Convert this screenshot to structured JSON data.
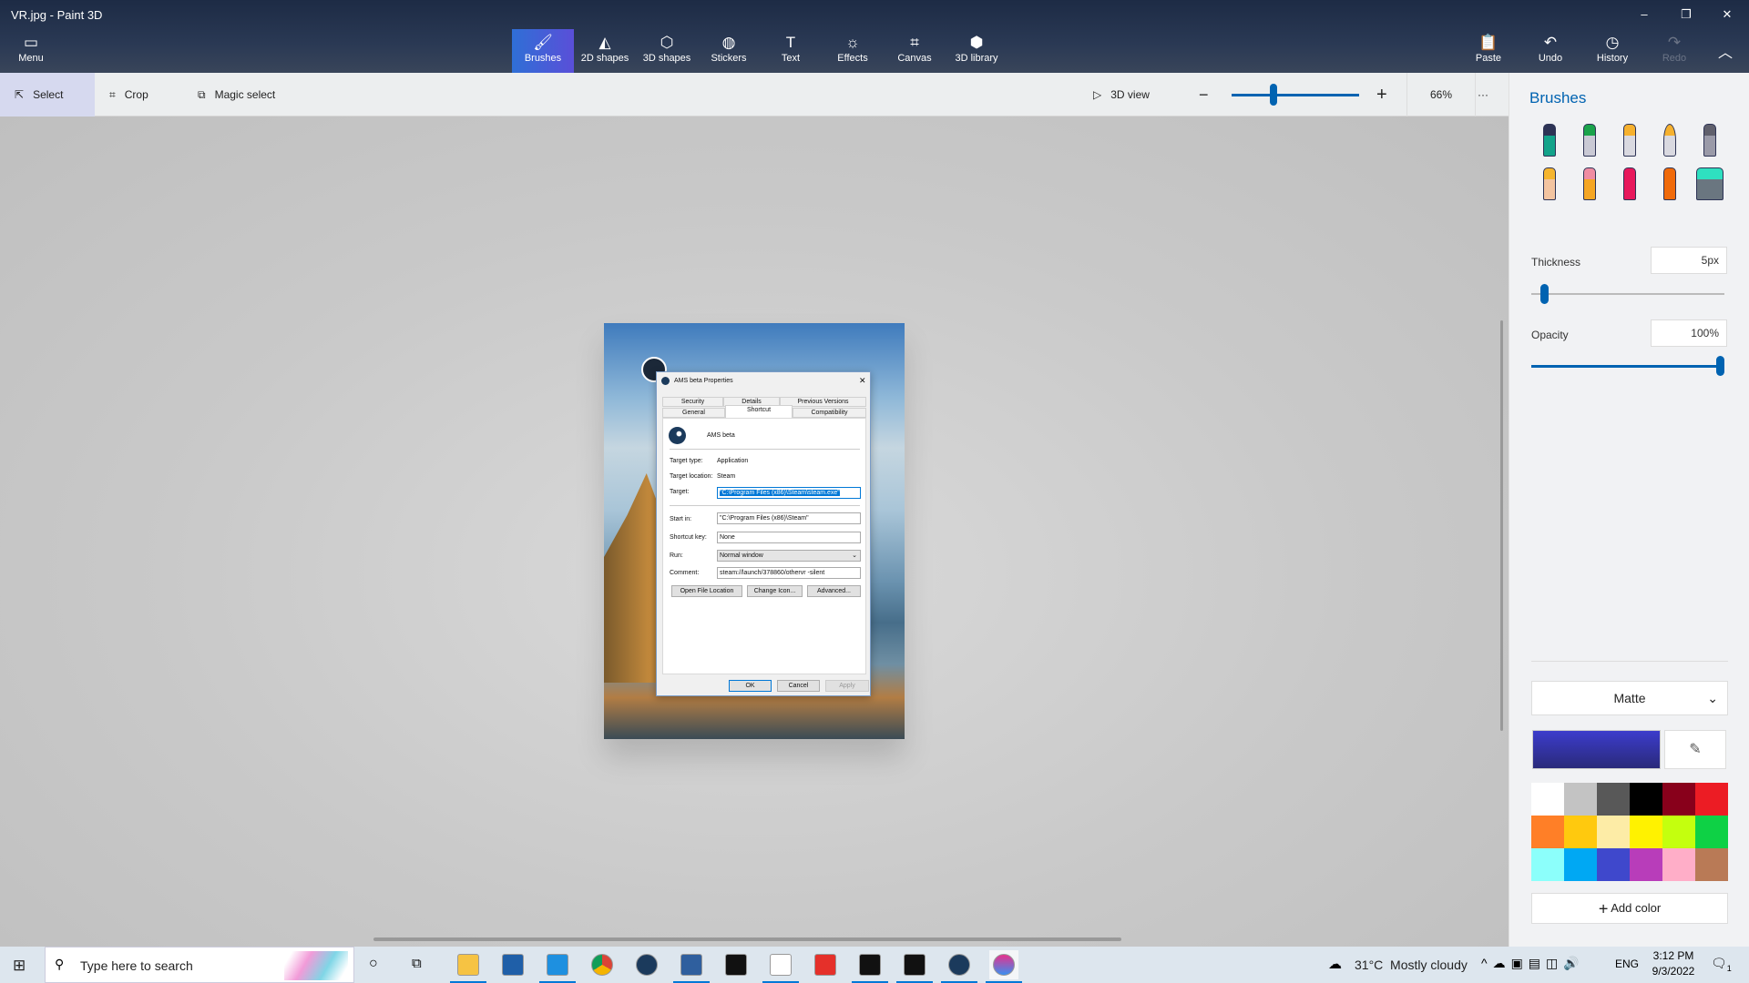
{
  "window": {
    "title": "VR.jpg - Paint 3D",
    "minimize": "–",
    "maximize": "❐",
    "close": "✕"
  },
  "menu": {
    "label": "Menu"
  },
  "tools": [
    {
      "label": "Brushes",
      "icon": "brush-icon",
      "active": true
    },
    {
      "label": "2D shapes",
      "icon": "2d-shapes-icon"
    },
    {
      "label": "3D shapes",
      "icon": "3d-shapes-icon"
    },
    {
      "label": "Stickers",
      "icon": "stickers-icon"
    },
    {
      "label": "Text",
      "icon": "text-icon"
    },
    {
      "label": "Effects",
      "icon": "effects-icon"
    },
    {
      "label": "Canvas",
      "icon": "canvas-icon"
    },
    {
      "label": "3D library",
      "icon": "3d-library-icon"
    }
  ],
  "actions": [
    {
      "label": "Paste"
    },
    {
      "label": "Undo"
    },
    {
      "label": "History"
    },
    {
      "label": "Redo",
      "disabled": true
    }
  ],
  "toolbar": {
    "select": "Select",
    "crop": "Crop",
    "magic_select": "Magic select",
    "view3d": "3D view",
    "zoom": "66%",
    "zoom_fraction": 0.33,
    "more": "···"
  },
  "dialog": {
    "title": "AMS beta Properties",
    "tabs_row1": [
      "Security",
      "Details",
      "Previous Versions"
    ],
    "tabs_row2": [
      "General",
      "Shortcut",
      "Compatibility"
    ],
    "selected_tab": "Shortcut",
    "name": "AMS beta",
    "fields": {
      "target_type_label": "Target type:",
      "target_type": "Application",
      "target_location_label": "Target location:",
      "target_location": "Steam",
      "target_label": "Target:",
      "target": "\"C:\\Program Files (x86)\\Steam\\steam.exe\"",
      "start_in_label": "Start in:",
      "start_in": "\"C:\\Program Files (x86)\\Steam\"",
      "shortcut_key_label": "Shortcut key:",
      "shortcut_key": "None",
      "run_label": "Run:",
      "run": "Normal window",
      "comment_label": "Comment:",
      "comment": "steam://launch/378860/othervr -silent"
    },
    "buttons": {
      "open_file_location": "Open File Location",
      "change_icon": "Change Icon...",
      "advanced": "Advanced...",
      "ok": "OK",
      "cancel": "Cancel",
      "apply": "Apply"
    }
  },
  "panel": {
    "title": "Brushes",
    "brushes": [
      "marker",
      "calligraphy-pen",
      "oil-brush",
      "watercolor",
      "pixel-pen",
      "pencil",
      "eraser",
      "crayon",
      "spray-can",
      "fill"
    ],
    "thickness_label": "Thickness",
    "thickness": "5px",
    "thickness_fraction": 0.05,
    "opacity_label": "Opacity",
    "opacity": "100%",
    "opacity_fraction": 1.0,
    "finish": "Matte",
    "current_color": "#3c3ccc",
    "add_color": "Add color",
    "palette": [
      "#ffffff",
      "#c3c3c3",
      "#585858",
      "#000000",
      "#88001b",
      "#ec1c24",
      "#ff7f27",
      "#ffc90e",
      "#fdeca6",
      "#fff200",
      "#c4ff0e",
      "#0ed145",
      "#8cfffb",
      "#00a8f3",
      "#3f48cc",
      "#b83dba",
      "#ffaec8",
      "#b97a56"
    ]
  },
  "taskbar": {
    "search_placeholder": "Type here to search",
    "apps": [
      "file-explorer",
      "microsoft-store",
      "mail",
      "chrome",
      "steam",
      "dcs",
      "oculus-app",
      "oculus",
      "app-red",
      "oculus-dark",
      "app-black",
      "steam",
      "paint-3d"
    ],
    "weather": "31°C  Mostly cloudy",
    "lang": "ENG",
    "time": "3:12 PM",
    "date": "9/3/2022",
    "notifications": "1"
  }
}
